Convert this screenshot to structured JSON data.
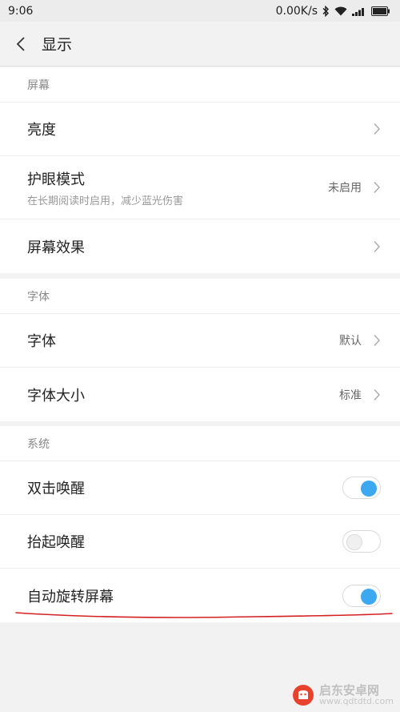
{
  "status_bar": {
    "time": "9:06",
    "speed": "0.00K/s"
  },
  "header": {
    "title": "显示"
  },
  "sections": [
    {
      "label": "屏幕",
      "rows": [
        {
          "title": "亮度"
        },
        {
          "title": "护眼模式",
          "subtitle": "在长期阅读时启用，减少蓝光伤害",
          "value": "未启用"
        },
        {
          "title": "屏幕效果"
        }
      ]
    },
    {
      "label": "字体",
      "rows": [
        {
          "title": "字体",
          "value": "默认"
        },
        {
          "title": "字体大小",
          "value": "标准"
        }
      ]
    },
    {
      "label": "系统",
      "rows": [
        {
          "title": "双击唤醒",
          "toggle": "on"
        },
        {
          "title": "抬起唤醒",
          "toggle": "off"
        },
        {
          "title": "自动旋转屏幕",
          "toggle": "on"
        }
      ]
    }
  ],
  "watermark": {
    "name": "启东安卓网",
    "url": "www.qdtdtd.com",
    "color": "#e8422f"
  },
  "colors": {
    "accent": "#3ba8f0",
    "annotation": "#d42020"
  }
}
